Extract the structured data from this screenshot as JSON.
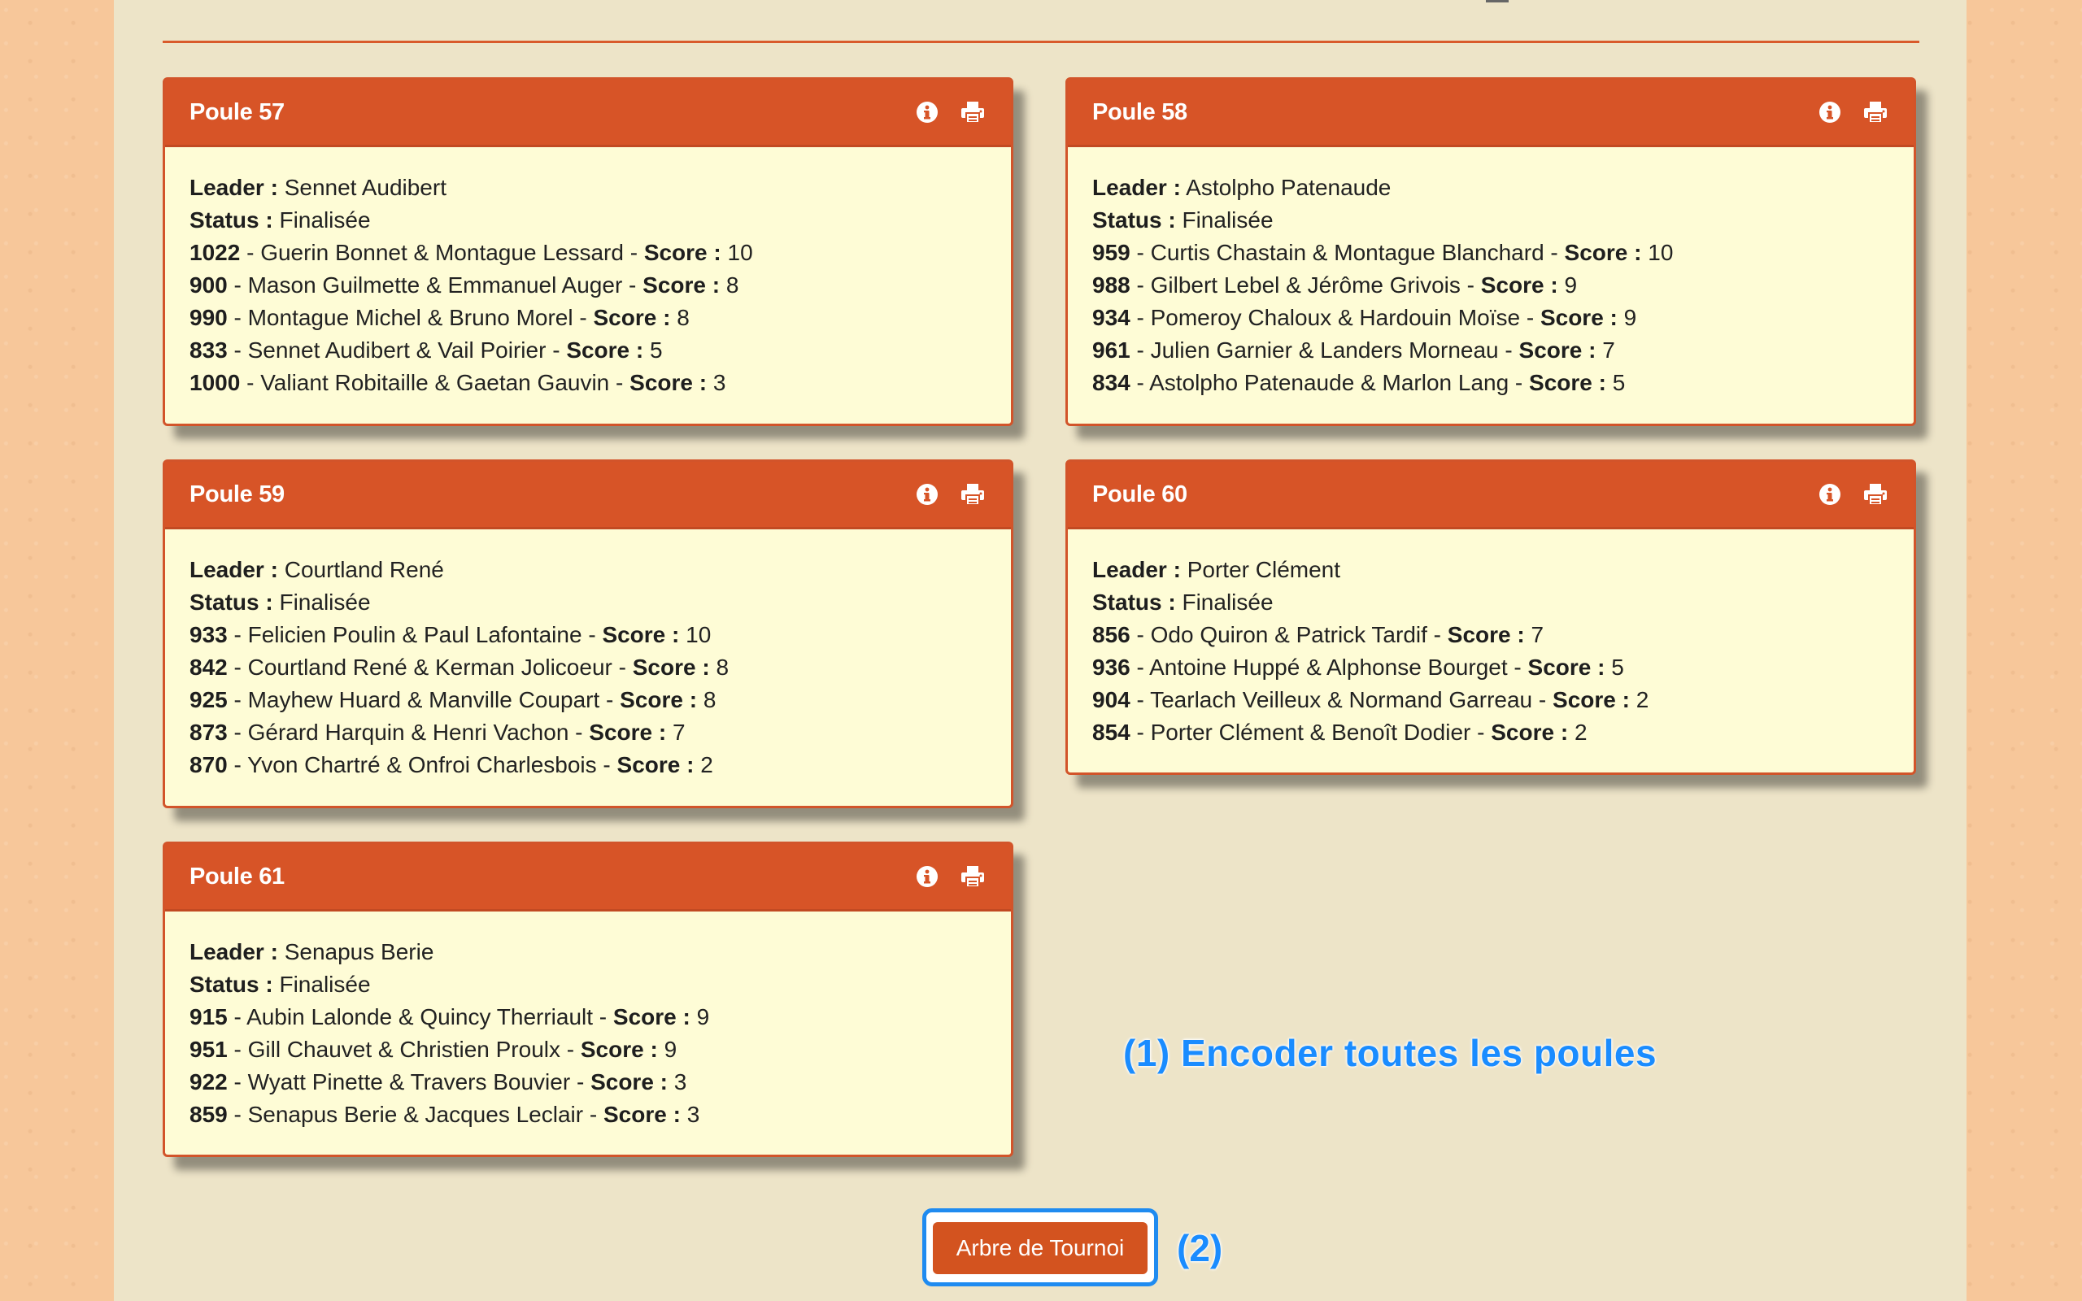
{
  "poules": [
    {
      "title": "Poule 57",
      "leader_label": "Leader :",
      "leader": "Sennet Audibert",
      "status_label": "Status :",
      "status": "Finalisée",
      "teams": [
        {
          "id": "1022",
          "names": "Guerin Bonnet & Montague Lessard",
          "score_label": "Score :",
          "score": "10"
        },
        {
          "id": "900",
          "names": "Mason Guilmette & Emmanuel Auger",
          "score_label": "Score :",
          "score": "8"
        },
        {
          "id": "990",
          "names": "Montague Michel & Bruno Morel",
          "score_label": "Score :",
          "score": "8"
        },
        {
          "id": "833",
          "names": "Sennet Audibert & Vail Poirier",
          "score_label": "Score :",
          "score": "5"
        },
        {
          "id": "1000",
          "names": "Valiant Robitaille & Gaetan Gauvin",
          "score_label": "Score :",
          "score": "3"
        }
      ]
    },
    {
      "title": "Poule 58",
      "leader_label": "Leader :",
      "leader": "Astolpho Patenaude",
      "status_label": "Status :",
      "status": "Finalisée",
      "teams": [
        {
          "id": "959",
          "names": "Curtis Chastain & Montague Blanchard",
          "score_label": "Score :",
          "score": "10"
        },
        {
          "id": "988",
          "names": "Gilbert Lebel & Jérôme Grivois",
          "score_label": "Score :",
          "score": "9"
        },
        {
          "id": "934",
          "names": "Pomeroy Chaloux & Hardouin Moïse",
          "score_label": "Score :",
          "score": "9"
        },
        {
          "id": "961",
          "names": "Julien Garnier & Landers Morneau",
          "score_label": "Score :",
          "score": "7"
        },
        {
          "id": "834",
          "names": "Astolpho Patenaude & Marlon Lang",
          "score_label": "Score :",
          "score": "5"
        }
      ]
    },
    {
      "title": "Poule 59",
      "leader_label": "Leader :",
      "leader": "Courtland René",
      "status_label": "Status :",
      "status": "Finalisée",
      "teams": [
        {
          "id": "933",
          "names": "Felicien Poulin & Paul Lafontaine",
          "score_label": "Score :",
          "score": "10"
        },
        {
          "id": "842",
          "names": "Courtland René & Kerman Jolicoeur",
          "score_label": "Score :",
          "score": "8"
        },
        {
          "id": "925",
          "names": "Mayhew Huard & Manville Coupart",
          "score_label": "Score :",
          "score": "8"
        },
        {
          "id": "873",
          "names": "Gérard Harquin & Henri Vachon",
          "score_label": "Score :",
          "score": "7"
        },
        {
          "id": "870",
          "names": "Yvon Chartré & Onfroi Charlesbois",
          "score_label": "Score :",
          "score": "2"
        }
      ]
    },
    {
      "title": "Poule 60",
      "leader_label": "Leader :",
      "leader": "Porter Clément",
      "status_label": "Status :",
      "status": "Finalisée",
      "teams": [
        {
          "id": "856",
          "names": "Odo Quiron & Patrick Tardif",
          "score_label": "Score :",
          "score": "7"
        },
        {
          "id": "936",
          "names": "Antoine Huppé & Alphonse Bourget",
          "score_label": "Score :",
          "score": "5"
        },
        {
          "id": "904",
          "names": "Tearlach Veilleux & Normand Garreau",
          "score_label": "Score :",
          "score": "2"
        },
        {
          "id": "854",
          "names": "Porter Clément & Benoît Dodier",
          "score_label": "Score :",
          "score": "2"
        }
      ]
    },
    {
      "title": "Poule 61",
      "leader_label": "Leader :",
      "leader": "Senapus Berie",
      "status_label": "Status :",
      "status": "Finalisée",
      "teams": [
        {
          "id": "915",
          "names": "Aubin Lalonde & Quincy Therriault",
          "score_label": "Score :",
          "score": "9"
        },
        {
          "id": "951",
          "names": "Gill Chauvet & Christien Proulx",
          "score_label": "Score :",
          "score": "9"
        },
        {
          "id": "922",
          "names": "Wyatt Pinette & Travers Bouvier",
          "score_label": "Score :",
          "score": "3"
        },
        {
          "id": "859",
          "names": "Senapus Berie & Jacques Leclair",
          "score_label": "Score :",
          "score": "3"
        }
      ]
    }
  ],
  "icons": {
    "info": "info-circle-icon",
    "print": "printer-icon"
  },
  "annotations": {
    "step1": "(1) Encoder toutes les poules",
    "step2": "(2)"
  },
  "actions": {
    "tournament_tree": "Arbre de Tournoi"
  },
  "colors": {
    "panel_header": "#d75427",
    "panel_body": "#fefcd6",
    "annotation": "#1a8cff",
    "button": "#d3531f",
    "page_bg": "#ede4c8",
    "outer_bg": "#f7c79a"
  }
}
